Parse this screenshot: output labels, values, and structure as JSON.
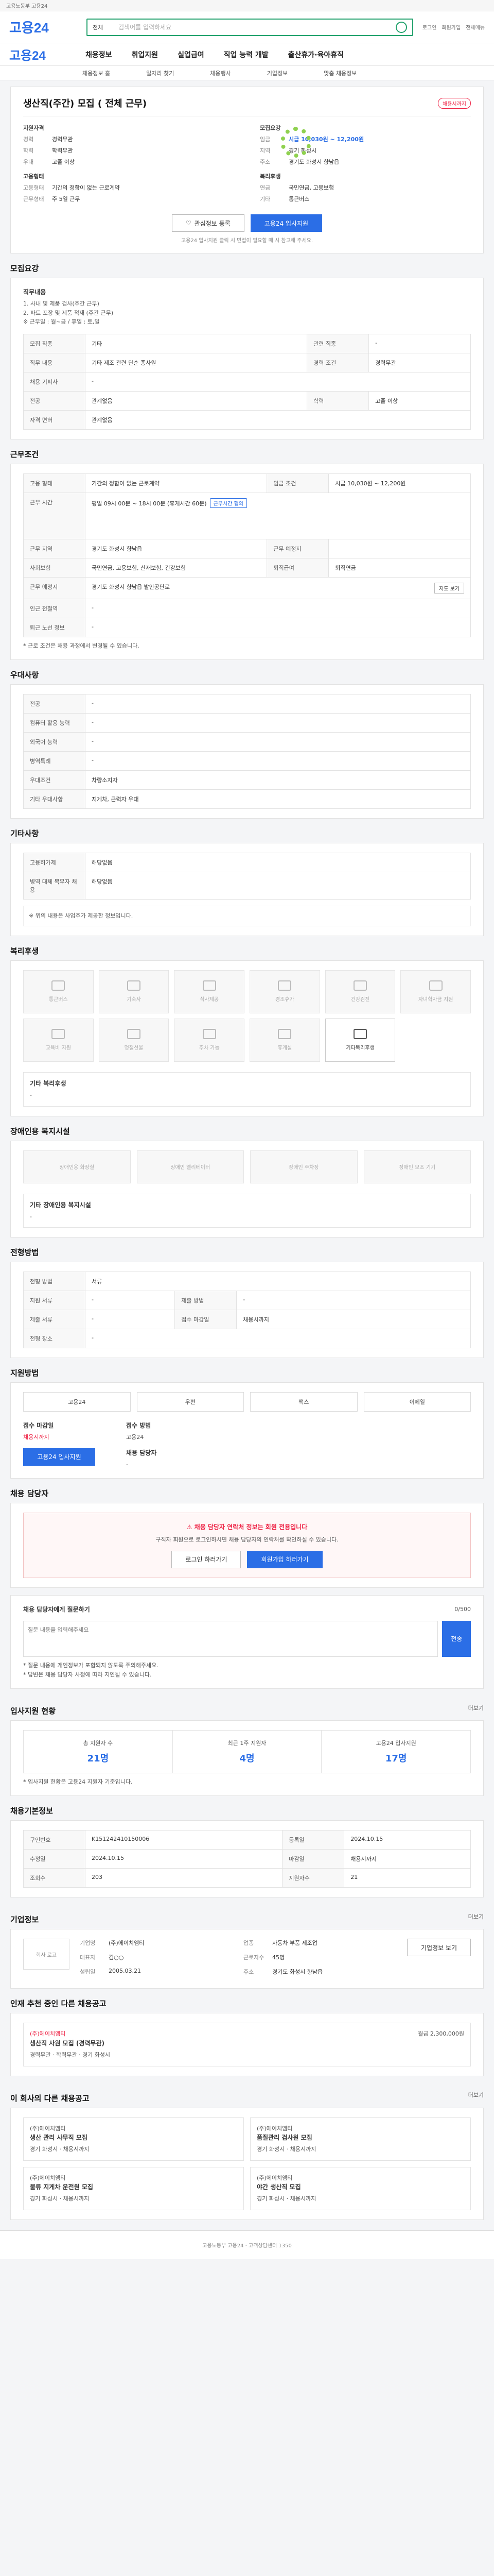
{
  "topbar": {
    "label": "고용노동부 고용24"
  },
  "header": {
    "logo": "고용24",
    "search_scope": "전체",
    "search_placeholder": "검색어를 입력하세요",
    "util_links": [
      "로그인",
      "회원가입",
      "전체메뉴"
    ]
  },
  "nav": {
    "brand": "고용24",
    "items": [
      "채용정보",
      "취업지원",
      "실업급여",
      "직업 능력 개발",
      "출산휴가·육아휴직"
    ]
  },
  "subnav": [
    "채용정보 홈",
    "일자리 찾기",
    "채용행사",
    "기업정보",
    "맞춤 채용정보"
  ],
  "job": {
    "title": "생산직(주간) 모집 ( 전체 근무)",
    "badge": "채용시까지",
    "left_title": "지원자격",
    "left": [
      {
        "k": "경력",
        "v": "경력무관"
      },
      {
        "k": "학력",
        "v": "학력무관"
      },
      {
        "k": "우대",
        "v": "고졸 이상"
      }
    ],
    "left2_title": "고용형태",
    "left2": [
      {
        "k": "고용형태",
        "v": "기간의 정함이 없는 근로계약"
      },
      {
        "k": "근무형태",
        "v": "주 5일 근무"
      }
    ],
    "right_title": "모집요강",
    "right": [
      {
        "k": "임금",
        "v": "시급 10,030원 ~ 12,200원"
      },
      {
        "k": "지역",
        "v": "경기 화성시"
      },
      {
        "k": "주소",
        "v": "경기도 화성시 향남읍"
      }
    ],
    "right2_title": "복리후생",
    "right2": [
      {
        "k": "연금",
        "v": "국민연금, 고용보험"
      },
      {
        "k": "기타",
        "v": "통근버스"
      }
    ],
    "btn_interest": "관심정보 등록",
    "btn_apply": "고용24 입사지원",
    "note": "고용24 입사지원 클릭 시 면접이 필요할 때 시 참고해 주세요."
  },
  "recruit": {
    "heading": "모집요강",
    "duty_title": "직무내용",
    "duty_lines": [
      "1. 사내 및 제품 검사(주간 근무)",
      "2. 파트 포장 및 제품 적재 (주간 근무)",
      "※ 근무일 : 월~금 / 휴일 : 토,일"
    ],
    "rows": [
      [
        "모집 직종",
        "기타",
        "관련 직종",
        "-"
      ],
      [
        "직무 내용",
        "기타 제조 관련 단순 종사원",
        "경력 조건",
        "경력무관"
      ],
      [
        "채용 기피사",
        "-",
        "",
        ""
      ],
      [
        "전공",
        "관계없음",
        "학력",
        "고졸 이상"
      ],
      [
        "자격 면허",
        "관계없음",
        "",
        ""
      ]
    ]
  },
  "condition": {
    "heading": "근무조건",
    "rows": [
      [
        "고용 형태",
        "기간의 정함이 없는 근로계약",
        "임금 조건",
        "시급 10,030원 ~ 12,200원"
      ],
      [
        "근무 시간",
        "평일 09시 00분 ~ 18시 00분 (휴게시간 60분)",
        "",
        ""
      ],
      [
        "근무 지역",
        "경기도 화성시 향남읍",
        "근무 예정지",
        ""
      ],
      [
        "사회보험",
        "국민연금, 고용보험, 산재보험, 건강보험",
        "퇴직급여",
        "퇴직연금"
      ],
      [
        "근무 예정지",
        "경기도 화성시 향남읍 발안공단로",
        "",
        ""
      ],
      [
        "인근 전철역",
        "-",
        "",
        ""
      ],
      [
        "퇴근 노선 정보",
        "-",
        "",
        ""
      ]
    ],
    "map_btn": "지도 보기",
    "tag": "근무시간 협의",
    "note": "* 근로 조건은 채용 과정에서 변경될 수 있습니다."
  },
  "preference": {
    "heading": "우대사항",
    "rows": [
      [
        "전공",
        "-"
      ],
      [
        "컴퓨터 활용 능력",
        "-"
      ],
      [
        "외국어 능력",
        "-"
      ],
      [
        "병역특례",
        "-"
      ],
      [
        "우대조건",
        "차량소지자"
      ],
      [
        "기타 우대사항",
        "지게차, 근력자 우대"
      ]
    ]
  },
  "other": {
    "heading": "기타사항",
    "rows": [
      [
        "고용허가제",
        "해당없음"
      ],
      [
        "병역 대체 복무자 채용",
        "해당없음"
      ]
    ],
    "note": "※ 위의 내용은 사업주가 제공한 정보입니다."
  },
  "welfare": {
    "heading": "복리후생",
    "items": [
      {
        "label": "통근버스",
        "active": false
      },
      {
        "label": "기숙사",
        "active": false
      },
      {
        "label": "식사제공",
        "active": false
      },
      {
        "label": "경조휴가",
        "active": false
      },
      {
        "label": "건강검진",
        "active": false
      },
      {
        "label": "자녀학자금 지원",
        "active": false
      },
      {
        "label": "교육비 지원",
        "active": false
      },
      {
        "label": "명절선물",
        "active": false
      },
      {
        "label": "주차 가능",
        "active": false
      },
      {
        "label": "휴게실",
        "active": false
      },
      {
        "label": "기타복리후생",
        "active": true
      }
    ],
    "other_label": "기타 복리후생",
    "other_value": "-"
  },
  "accessibility": {
    "heading": "장애인용 복지시설",
    "items": [
      "장애인용 화장실",
      "장애인 엘리베이터",
      "장애인 주차장",
      "장애인 보조 기기"
    ],
    "other_label": "기타 장애인용 복지시설",
    "other_value": "-"
  },
  "screening": {
    "heading": "전형방법",
    "rows": [
      [
        "전형 방법",
        "서류",
        "",
        ""
      ],
      [
        "지원 서류",
        "-",
        "제출 방법",
        "-"
      ],
      [
        "제출 서류",
        "-",
        "접수 마감일",
        "채용시까지"
      ],
      [
        "전형 장소",
        "-",
        "",
        ""
      ]
    ]
  },
  "apply_methods": {
    "heading": "지원방법",
    "methods": [
      "고용24",
      "우편",
      "팩스",
      "이메일"
    ]
  },
  "contact": {
    "receipt_label": "접수 마감일",
    "receipt_value": "채용시까지",
    "doc_label": "접수 방법",
    "doc_value": "고용24",
    "apply_btn": "고용24 입사지원",
    "person_label": "채용 담당자",
    "person_value": "-"
  },
  "manager": {
    "heading": "채용 담당자",
    "alert_title": "채용 담당자 연락처 정보는 회원 전용입니다",
    "alert_body": "구직자 회원으로 로그인하시면 채용 담당자의 연락처를 확인하실 수 있습니다.",
    "btn_login": "로그인 하러가기",
    "btn_join": "회원가입 하러가기"
  },
  "qna": {
    "heading": "채용 담당자에게 질문하기",
    "counter": "0/500",
    "placeholder": "질문 내용을 입력해주세요",
    "submit": "전송",
    "notes": [
      "* 질문 내용에 개인정보가 포함되지 않도록 주의해주세요.",
      "* 답변은 채용 담당자 사정에 따라 지연될 수 있습니다."
    ]
  },
  "stats": {
    "heading": "입사지원 현황",
    "more": "더보기",
    "items": [
      {
        "label": "총 지원자 수",
        "value": "21명"
      },
      {
        "label": "최근 1주 지원자",
        "value": "4명"
      },
      {
        "label": "고용24 입사지원",
        "value": "17명"
      }
    ],
    "note": "* 입사지원 현황은 고용24 지원자 기준입니다."
  },
  "info": {
    "heading": "채용기본정보",
    "rows": [
      [
        "구인번호",
        "K151242410150006",
        "등록일",
        "2024.10.15"
      ],
      [
        "수정일",
        "2024.10.15",
        "마감일",
        "채용시까지"
      ],
      [
        "조회수",
        "203",
        "지원자수",
        "21"
      ]
    ]
  },
  "company": {
    "heading": "기업정보",
    "more": "더보기",
    "logo_alt": "회사 로고",
    "fields": [
      {
        "k": "기업명",
        "v": "(주)에이치엠티"
      },
      {
        "k": "업종",
        "v": "자동차 부품 제조업"
      },
      {
        "k": "대표자",
        "v": "김○○"
      },
      {
        "k": "근로자수",
        "v": "45명"
      },
      {
        "k": "설립일",
        "v": "2005.03.21"
      },
      {
        "k": "주소",
        "v": "경기도 화성시 향남읍"
      }
    ],
    "btn_more": "기업정보 보기"
  },
  "other_jobs": {
    "heading": "인재 추천 중인 다른 채용공고",
    "list": [
      {
        "org": "(주)에이치엠티",
        "title": "생산직 사원 모집 (경력무관)",
        "meta": "경력무관 · 학력무관 · 경기 화성시",
        "wage": "월급 2,300,000원"
      }
    ]
  },
  "related": {
    "heading": "이 회사의 다른 채용공고",
    "more": "더보기",
    "cards": [
      {
        "org": "(주)에이치엠티",
        "title": "생산 관리 사무직 모집",
        "meta": "경기 화성시 · 채용시까지"
      },
      {
        "org": "(주)에이치엠티",
        "title": "품질관리 검사원 모집",
        "meta": "경기 화성시 · 채용시까지"
      },
      {
        "org": "(주)에이치엠티",
        "title": "물류 지게차 운전원 모집",
        "meta": "경기 화성시 · 채용시까지"
      },
      {
        "org": "(주)에이치엠티",
        "title": "야간 생산직 모집",
        "meta": "경기 화성시 · 채용시까지"
      }
    ]
  },
  "footer": {
    "text": "고용노동부 고용24 · 고객상담센터 1350"
  }
}
